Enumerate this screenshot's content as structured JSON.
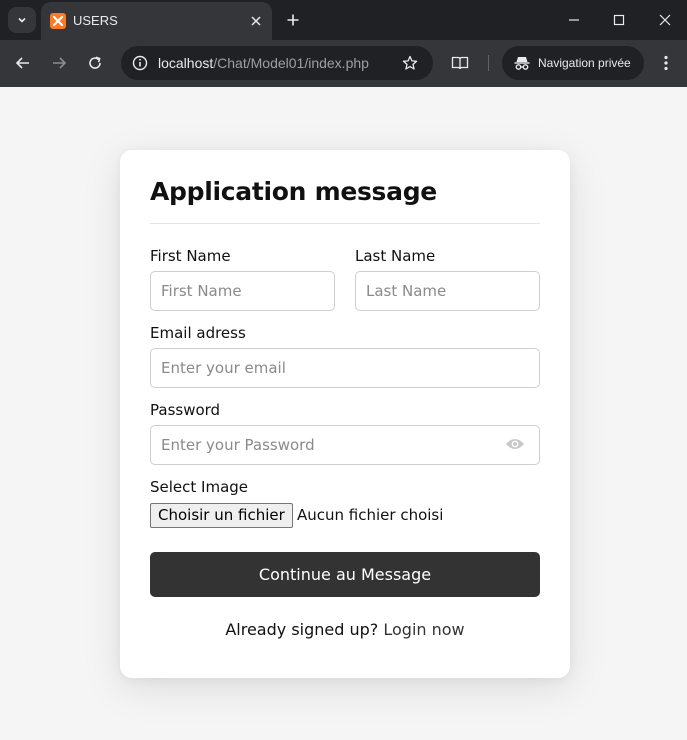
{
  "browser": {
    "tab": {
      "title": "USERS"
    },
    "address": {
      "host": "localhost",
      "path": "/Chat/Model01/index.php"
    },
    "incognito_label": "Navigation privée"
  },
  "form": {
    "title": "Application message",
    "first_name": {
      "label": "First Name",
      "placeholder": "First Name",
      "value": ""
    },
    "last_name": {
      "label": "Last Name",
      "placeholder": "Last Name",
      "value": ""
    },
    "email": {
      "label": "Email adress",
      "placeholder": "Enter your email",
      "value": ""
    },
    "password": {
      "label": "Password",
      "placeholder": "Enter your Password",
      "value": ""
    },
    "image": {
      "label": "Select Image",
      "button_label": "Choisir un fichier",
      "status": "Aucun fichier choisi"
    },
    "submit_label": "Continue au Message",
    "signin_prompt": "Already signed up?",
    "signin_link": "Login now"
  },
  "icons": {
    "tab_menu": "chevron-down-icon",
    "favicon": "xampp-icon",
    "tab_close": "close-icon",
    "new_tab": "plus-icon",
    "minimize": "minimize-icon",
    "maximize": "maximize-icon",
    "window_close": "close-icon",
    "back": "arrow-left-icon",
    "forward": "arrow-right-icon",
    "reload": "reload-icon",
    "site_info": "info-icon",
    "bookmark": "star-icon",
    "reader": "reader-mode-icon",
    "incognito": "incognito-icon",
    "menu": "kebab-menu-icon",
    "show_password": "eye-icon"
  },
  "colors": {
    "chrome_dark": "#202124",
    "chrome_tab": "#35363a",
    "favicon": "#fb7a24",
    "button_bg": "#333333",
    "page_bg": "#f5f5f5"
  }
}
